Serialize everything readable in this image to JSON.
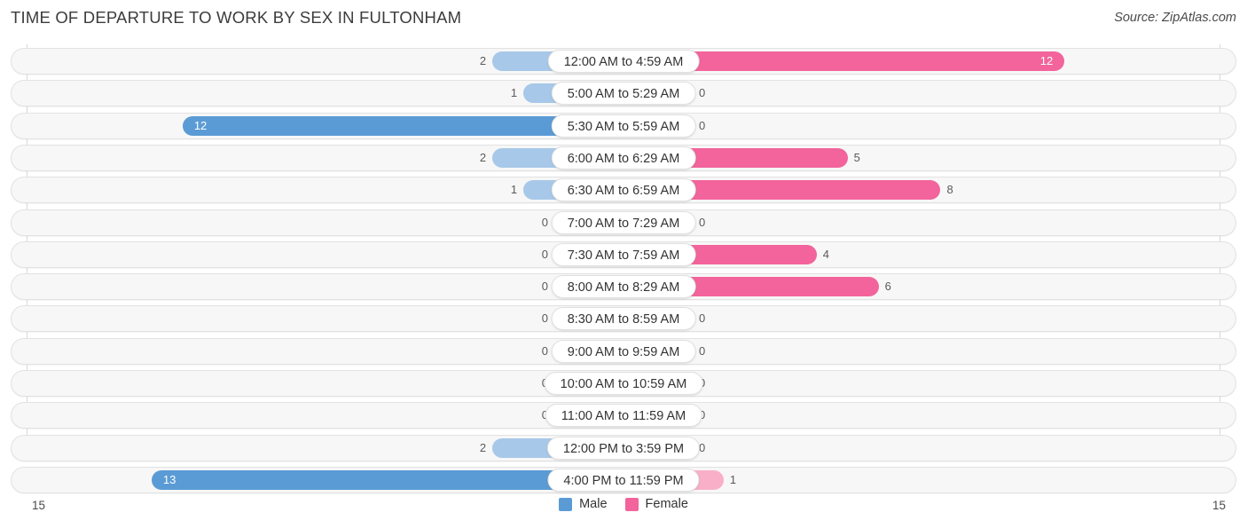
{
  "header": {
    "title": "TIME OF DEPARTURE TO WORK BY SEX IN FULTONHAM",
    "source": "Source: ZipAtlas.com"
  },
  "legend": {
    "male_label": "Male",
    "female_label": "Female",
    "male_color": "#5b9bd5",
    "female_color": "#f2649b"
  },
  "axis": {
    "left_max_label": "15",
    "right_max_label": "15"
  },
  "colors": {
    "male_light": "#a7c8e8",
    "male_dark": "#5b9bd5",
    "female_light": "#f9afc8",
    "female_dark": "#f2649b",
    "track_fill": "#f7f7f7",
    "track_border": "#e2e2e2",
    "gridline": "#d8d8d8"
  },
  "chart_data": {
    "type": "bar",
    "subtype": "diverging-horizontal",
    "title": "TIME OF DEPARTURE TO WORK BY SEX IN FULTONHAM",
    "xlabel": "",
    "ylabel": "",
    "xlim": [
      15,
      15
    ],
    "grid": true,
    "legend_position": "bottom-center",
    "categories": [
      "12:00 AM to 4:59 AM",
      "5:00 AM to 5:29 AM",
      "5:30 AM to 5:59 AM",
      "6:00 AM to 6:29 AM",
      "6:30 AM to 6:59 AM",
      "7:00 AM to 7:29 AM",
      "7:30 AM to 7:59 AM",
      "8:00 AM to 8:29 AM",
      "8:30 AM to 8:59 AM",
      "9:00 AM to 9:59 AM",
      "10:00 AM to 10:59 AM",
      "11:00 AM to 11:59 AM",
      "12:00 PM to 3:59 PM",
      "4:00 PM to 11:59 PM"
    ],
    "series": [
      {
        "name": "Male",
        "direction": "left",
        "values": [
          2,
          1,
          12,
          2,
          1,
          0,
          0,
          0,
          0,
          0,
          0,
          0,
          2,
          13
        ]
      },
      {
        "name": "Female",
        "direction": "right",
        "values": [
          12,
          0,
          0,
          5,
          8,
          0,
          4,
          6,
          0,
          0,
          0,
          0,
          0,
          1
        ]
      }
    ]
  }
}
